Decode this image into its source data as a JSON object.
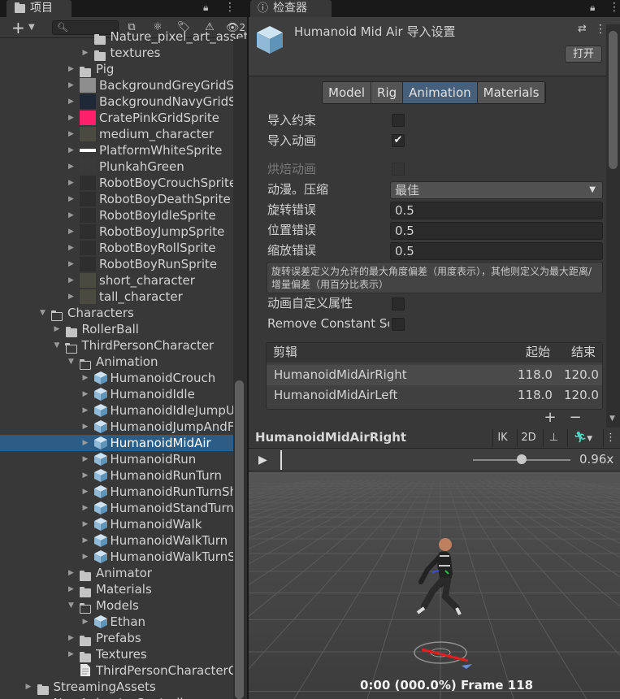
{
  "project": {
    "tab_label": "项目",
    "toolbar_icons": [
      "add-icon",
      "search-icon",
      "package-icon",
      "tag-icon",
      "warning-icon",
      "eye-hidden-icon"
    ],
    "hidden_count": "2",
    "tree": [
      {
        "depth": 6,
        "arrow": "",
        "icon": "folder",
        "label": "Nature_pixel_art_asset"
      },
      {
        "depth": 6,
        "arrow": "▶",
        "icon": "folder",
        "label": "textures"
      },
      {
        "depth": 5,
        "arrow": "▶",
        "icon": "folder",
        "label": "Pig"
      },
      {
        "depth": 5,
        "arrow": "▶",
        "icon": "thumb-grey",
        "label": "BackgroundGreyGridS"
      },
      {
        "depth": 5,
        "arrow": "▶",
        "icon": "thumb-navy",
        "label": "BackgroundNavyGridS"
      },
      {
        "depth": 5,
        "arrow": "▶",
        "icon": "thumb-pink",
        "label": "CratePinkGridSprite"
      },
      {
        "depth": 5,
        "arrow": "▶",
        "icon": "thumb-char",
        "label": "medium_character"
      },
      {
        "depth": 5,
        "arrow": "▶",
        "icon": "thumb-white",
        "label": "PlatformWhiteSprite"
      },
      {
        "depth": 5,
        "arrow": "▶",
        "icon": "thumb-green",
        "label": "PlunkahGreen"
      },
      {
        "depth": 5,
        "arrow": "▶",
        "icon": "thumb-robot",
        "label": "RobotBoyCrouchSprite"
      },
      {
        "depth": 5,
        "arrow": "▶",
        "icon": "thumb-robot",
        "label": "RobotBoyDeathSprite"
      },
      {
        "depth": 5,
        "arrow": "▶",
        "icon": "thumb-robot",
        "label": "RobotBoyIdleSprite"
      },
      {
        "depth": 5,
        "arrow": "▶",
        "icon": "thumb-robot",
        "label": "RobotBoyJumpSprite"
      },
      {
        "depth": 5,
        "arrow": "▶",
        "icon": "thumb-robot",
        "label": "RobotBoyRollSprite"
      },
      {
        "depth": 5,
        "arrow": "▶",
        "icon": "thumb-robot",
        "label": "RobotBoyRunSprite"
      },
      {
        "depth": 5,
        "arrow": "▶",
        "icon": "thumb-char",
        "label": "short_character"
      },
      {
        "depth": 5,
        "arrow": "▶",
        "icon": "thumb-char",
        "label": "tall_character"
      },
      {
        "depth": 3,
        "arrow": "▼",
        "icon": "folder-open",
        "label": "Characters"
      },
      {
        "depth": 4,
        "arrow": "▶",
        "icon": "folder",
        "label": "RollerBall"
      },
      {
        "depth": 4,
        "arrow": "▼",
        "icon": "folder-open",
        "label": "ThirdPersonCharacter"
      },
      {
        "depth": 5,
        "arrow": "▼",
        "icon": "folder-open",
        "label": "Animation"
      },
      {
        "depth": 6,
        "arrow": "▶",
        "icon": "cube",
        "label": "HumanoidCrouch"
      },
      {
        "depth": 6,
        "arrow": "▶",
        "icon": "cube",
        "label": "HumanoidIdle"
      },
      {
        "depth": 6,
        "arrow": "▶",
        "icon": "cube",
        "label": "HumanoidIdleJumpU"
      },
      {
        "depth": 6,
        "arrow": "▶",
        "icon": "cube",
        "label": "HumanoidJumpAndF"
      },
      {
        "depth": 6,
        "arrow": "▶",
        "icon": "cube",
        "label": "HumanoidMidAir",
        "selected": true
      },
      {
        "depth": 6,
        "arrow": "▶",
        "icon": "cube",
        "label": "HumanoidRun"
      },
      {
        "depth": 6,
        "arrow": "▶",
        "icon": "cube",
        "label": "HumanoidRunTurn"
      },
      {
        "depth": 6,
        "arrow": "▶",
        "icon": "cube",
        "label": "HumanoidRunTurnSh"
      },
      {
        "depth": 6,
        "arrow": "▶",
        "icon": "cube",
        "label": "HumanoidStandTurn"
      },
      {
        "depth": 6,
        "arrow": "▶",
        "icon": "cube",
        "label": "HumanoidWalk"
      },
      {
        "depth": 6,
        "arrow": "▶",
        "icon": "cube",
        "label": "HumanoidWalkTurn"
      },
      {
        "depth": 6,
        "arrow": "▶",
        "icon": "cube",
        "label": "HumanoidWalkTurnS"
      },
      {
        "depth": 5,
        "arrow": "▶",
        "icon": "folder",
        "label": "Animator"
      },
      {
        "depth": 5,
        "arrow": "▶",
        "icon": "folder",
        "label": "Materials"
      },
      {
        "depth": 5,
        "arrow": "▼",
        "icon": "folder-open",
        "label": "Models"
      },
      {
        "depth": 6,
        "arrow": "▶",
        "icon": "cube",
        "label": "Ethan"
      },
      {
        "depth": 5,
        "arrow": "▶",
        "icon": "folder",
        "label": "Prefabs"
      },
      {
        "depth": 5,
        "arrow": "▶",
        "icon": "folder",
        "label": "Textures"
      },
      {
        "depth": 5,
        "arrow": "",
        "icon": "doc",
        "label": "ThirdPersonCharacterC"
      },
      {
        "depth": 2,
        "arrow": "▶",
        "icon": "folder",
        "label": "StreamingAssets"
      },
      {
        "depth": 2,
        "arrow": "▶",
        "icon": "folder",
        "label": "NewAnimatorController"
      }
    ]
  },
  "inspector": {
    "tab_label": "检查器",
    "title": "Humanoid Mid Air 导入设置",
    "open_button": "打开",
    "tabs": [
      {
        "label": "Model",
        "active": false
      },
      {
        "label": "Rig",
        "active": false
      },
      {
        "label": "Animation",
        "active": true
      },
      {
        "label": "Materials",
        "active": false
      }
    ],
    "import_constraints_label": "导入约束",
    "import_constraints_checked": false,
    "import_animation_label": "导入动画",
    "import_animation_checked": true,
    "bake_animations_label": "烘焙动画",
    "anim_compression_label": "动漫。压缩",
    "anim_compression_value": "最佳",
    "rotation_error_label": "旋转错误",
    "rotation_error_value": "0.5",
    "position_error_label": "位置错误",
    "position_error_value": "0.5",
    "scale_error_label": "缩放错误",
    "scale_error_value": "0.5",
    "help_text": "旋转误差定义为允许的最大角度偏差（用度表示），其他则定义为最大距离/增量偏差（用百分比表示）",
    "custom_props_label": "动画自定义属性",
    "remove_constant_label": "Remove Constant Sc",
    "clips_header": {
      "name": "剪辑",
      "start": "起始",
      "end": "结束"
    },
    "clips": [
      {
        "name": "HumanoidMidAirRight",
        "start": "118.0",
        "end": "120.0",
        "selected": true
      },
      {
        "name": "HumanoidMidAirLeft",
        "start": "118.0",
        "end": "120.0",
        "selected": false
      }
    ],
    "add_symbol": "+",
    "remove_symbol": "−"
  },
  "preview": {
    "title": "HumanoidMidAirRight",
    "ik_label": "IK",
    "mode_2d_label": "2D",
    "speed": "0.96x",
    "speed_fraction": 0.5,
    "frame_info": "0:00 (000.0%) Frame 118"
  }
}
